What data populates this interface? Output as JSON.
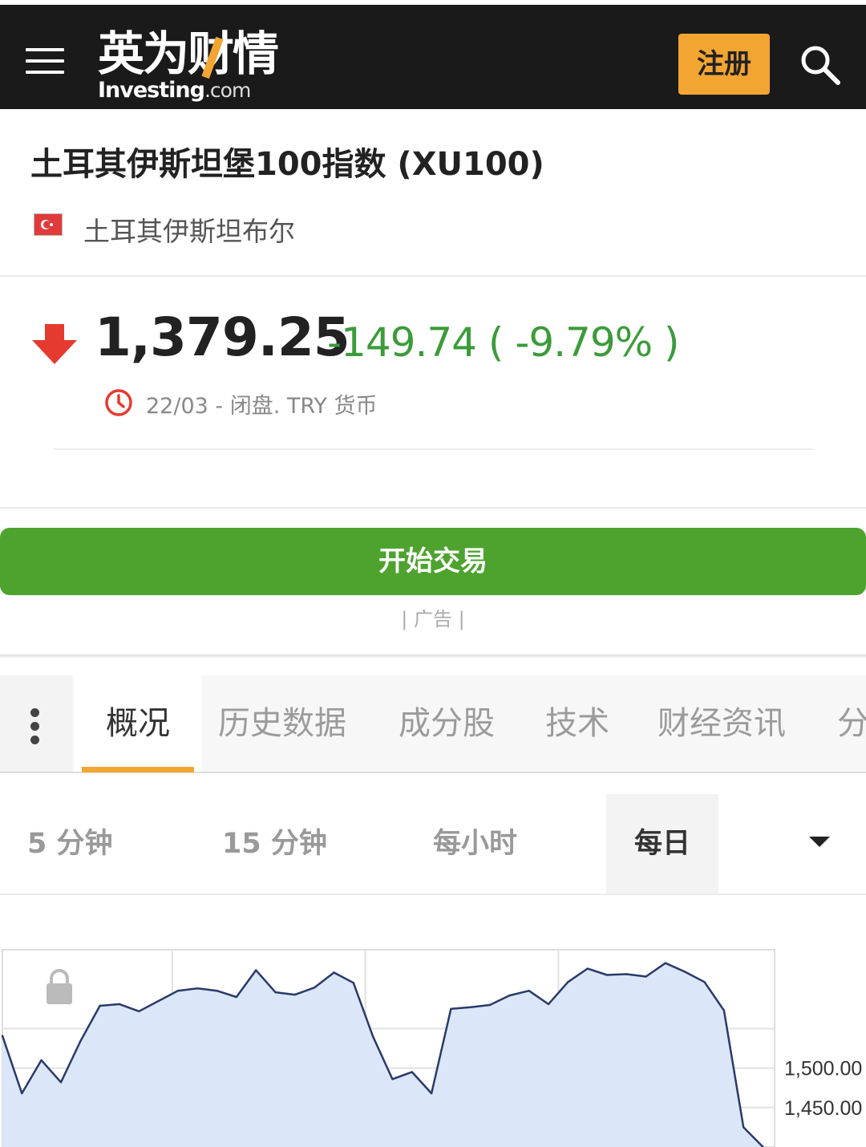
{
  "header": {
    "logo_cn": "英为财情",
    "logo_en_bold": "Investing",
    "logo_en_suffix": ".com",
    "register_label": "注册",
    "menu_icon": "hamburger-menu-icon",
    "search_icon": "search-icon",
    "accent_color": "#f3a532"
  },
  "instrument": {
    "title": "土耳其伊斯坦堡100指数 (XU100)",
    "exchange": "土耳其伊斯坦布尔",
    "flag_icon": "turkey-flag-icon"
  },
  "quote": {
    "price": "1,379.25",
    "change": "-149.74 ( -9.79% )",
    "status": "22/03 - 闭盘. TRY 货币",
    "direction_icon": "down-arrow-icon",
    "down_color": "#e53a2f",
    "change_color": "#3c9b3a"
  },
  "trade": {
    "button_label": "开始交易",
    "ad_label": "| 广告 |",
    "button_color": "#4ea32f"
  },
  "tabs": {
    "items": [
      {
        "label": "概况",
        "active": true
      },
      {
        "label": "历史数据",
        "active": false
      },
      {
        "label": "成分股",
        "active": false
      },
      {
        "label": "技术",
        "active": false
      },
      {
        "label": "财经资讯",
        "active": false
      },
      {
        "label": "分",
        "active": false
      }
    ]
  },
  "timeframes": {
    "items": [
      {
        "label": "5 分钟",
        "active": false
      },
      {
        "label": "15 分钟",
        "active": false
      },
      {
        "label": "每小时",
        "active": false
      },
      {
        "label": "每日",
        "active": true
      }
    ]
  },
  "chart_data": {
    "type": "area",
    "x": [
      1,
      2,
      3,
      4,
      5,
      6,
      7,
      8,
      9,
      10,
      11,
      12,
      13,
      14,
      15,
      16,
      17,
      18,
      19,
      20,
      21,
      22,
      23,
      24,
      25,
      26,
      27,
      28,
      29,
      30,
      31,
      32,
      33,
      34,
      35,
      36,
      37,
      38,
      39,
      40
    ],
    "values": [
      1541,
      1468,
      1510,
      1482,
      1534,
      1579,
      1581,
      1572,
      1585,
      1598,
      1601,
      1598,
      1590,
      1624,
      1596,
      1593,
      1602,
      1621,
      1608,
      1540,
      1486,
      1495,
      1468,
      1575,
      1577,
      1580,
      1592,
      1598,
      1581,
      1609,
      1626,
      1618,
      1619,
      1616,
      1633,
      1622,
      1609,
      1573,
      1425,
      1400
    ],
    "y_ticks": [
      "1,500.00",
      "1,450.00"
    ],
    "ylim": [
      1400,
      1650
    ],
    "grid": true,
    "lock_icon": "lock-icon",
    "line_color": "#2a3a6a",
    "fill_color": "#dbe7f8"
  }
}
